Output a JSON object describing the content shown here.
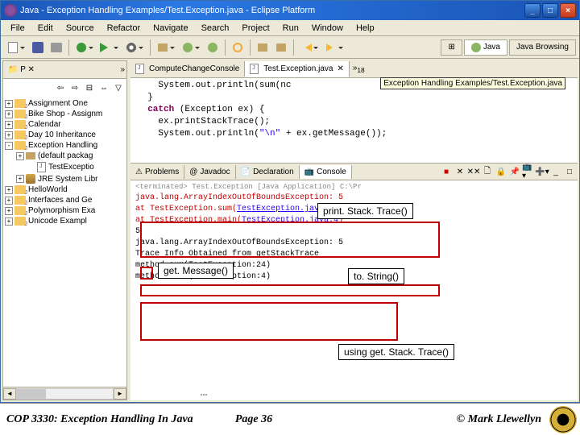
{
  "window": {
    "title": "Java - Exception Handling Examples/Test.Exception.java - Eclipse Platform"
  },
  "menu": [
    "File",
    "Edit",
    "Source",
    "Refactor",
    "Navigate",
    "Search",
    "Project",
    "Run",
    "Window",
    "Help"
  ],
  "perspectives": {
    "java": "Java",
    "browsing": "Java Browsing"
  },
  "sidebar": {
    "tab": "P",
    "double_arrow": "»",
    "items": [
      {
        "exp": "+",
        "label": "Assignment One"
      },
      {
        "exp": "+",
        "label": "Bike Shop - Assignm"
      },
      {
        "exp": "+",
        "label": "Calendar"
      },
      {
        "exp": "+",
        "label": "Day 10 Inheritance"
      },
      {
        "exp": "-",
        "label": "Exception Handling"
      },
      {
        "exp": "+",
        "label": "(default packag",
        "indent": 1,
        "type": "pkg"
      },
      {
        "exp": "",
        "label": "TestExceptio",
        "indent": 2,
        "type": "file"
      },
      {
        "exp": "+",
        "label": "JRE System Libr",
        "indent": 1,
        "type": "jar"
      },
      {
        "exp": "+",
        "label": "HelloWorld"
      },
      {
        "exp": "+",
        "label": "Interfaces and Ge"
      },
      {
        "exp": "+",
        "label": "Polymorphism Exa"
      },
      {
        "exp": "+",
        "label": "Unicode Exampl"
      }
    ]
  },
  "editor_tabs": {
    "left": "ComputeChangeConsole",
    "active": "Test.Exception.java",
    "double_arrow": "»",
    "count": "18"
  },
  "hint": "Exception Handling Examples/Test.Exception.java",
  "code": [
    "    System.out.println(sum(nc",
    "  }",
    "  catch (Exception ex) {",
    "    ex.printStackTrace();",
    "    System.out.println(\"\\n\" + ex.getMessage());"
  ],
  "views": {
    "problems": "Problems",
    "javadoc": "Javadoc",
    "declaration": "Declaration",
    "console": "Console"
  },
  "console": {
    "header": "<terminated> Test.Exception [Java Application] C:\\Pr",
    "lines": [
      {
        "type": "err",
        "text": "java.lang.ArrayIndexOutOfBoundsException: 5"
      },
      {
        "type": "err",
        "text": "    at TestException.sum(",
        "link": "TestException.java:24",
        "suffix": ")"
      },
      {
        "type": "err",
        "text": "    at TestException.main(",
        "link": "TestException.java:4",
        "suffix": ")"
      },
      {
        "type": "blank",
        "text": " "
      },
      {
        "type": "txt",
        "text": "5"
      },
      {
        "type": "txt",
        "text": "java.lang.ArrayIndexOutOfBoundsException: 5"
      },
      {
        "type": "blank",
        "text": " "
      },
      {
        "type": "txt",
        "text": "Trace Info Obtained from getStackTrace"
      },
      {
        "type": "txt",
        "text": "method sum(TestException:24)"
      },
      {
        "type": "txt",
        "text": "method main(TestException:4)"
      }
    ]
  },
  "callouts": {
    "printStackTrace": "print. Stack. Trace()",
    "getMessage": "get. Message()",
    "toString": "to. String()",
    "getStackTrace": "using get. Stack. Trace()"
  },
  "footer": {
    "left": "COP 3330: Exception Handling In Java",
    "mid": "Page 36",
    "right": "© Mark Llewellyn"
  }
}
